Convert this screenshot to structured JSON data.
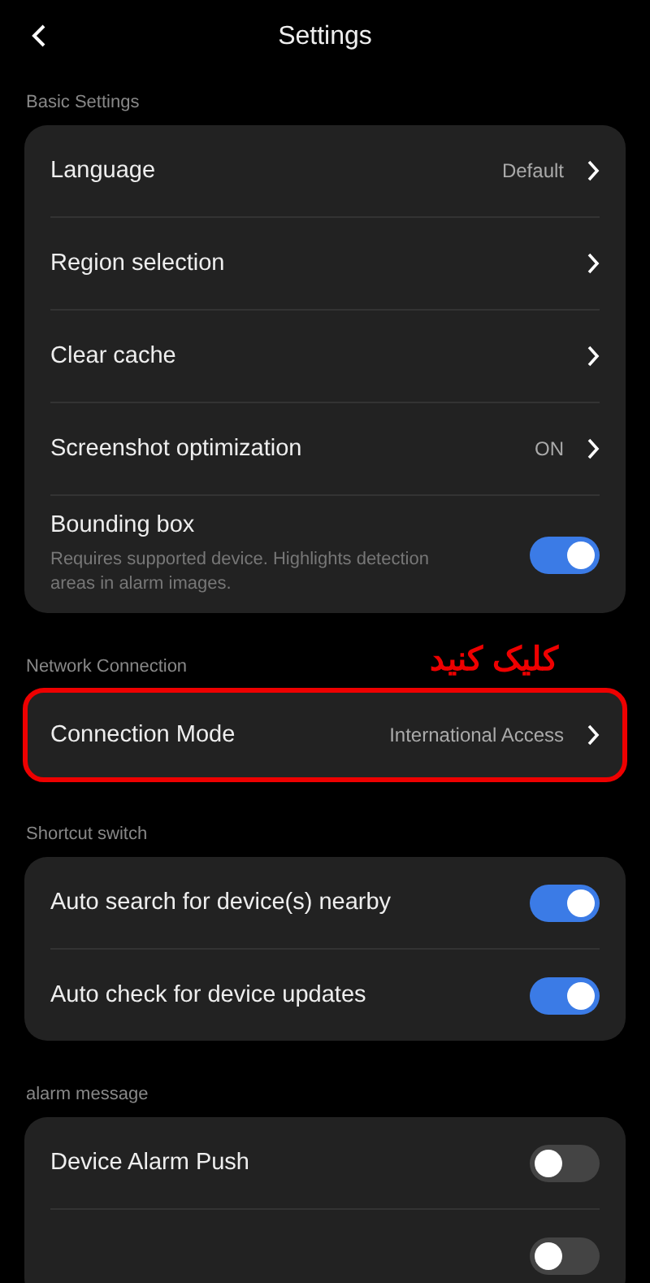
{
  "header": {
    "title": "Settings"
  },
  "sections": [
    {
      "title": "Basic Settings",
      "items": [
        {
          "kind": "link",
          "label": "Language",
          "value": "Default"
        },
        {
          "kind": "link",
          "label": "Region selection"
        },
        {
          "kind": "link",
          "label": "Clear cache"
        },
        {
          "kind": "link",
          "label": "Screenshot optimization",
          "value": "ON"
        },
        {
          "kind": "toggle",
          "label": "Bounding box",
          "description": "Requires supported device. Highlights detection areas in alarm images.",
          "on": true
        }
      ]
    },
    {
      "title": "Network Connection",
      "highlighted": true,
      "annotation": "کلیک کنید",
      "items": [
        {
          "kind": "link",
          "label": "Connection Mode",
          "value": "International Access"
        }
      ]
    },
    {
      "title": "Shortcut switch",
      "items": [
        {
          "kind": "toggle",
          "label": "Auto search for device(s) nearby",
          "on": true
        },
        {
          "kind": "toggle",
          "label": "Auto check for device updates",
          "on": true
        }
      ]
    },
    {
      "title": "alarm message",
      "items": [
        {
          "kind": "toggle",
          "label": "Device Alarm Push",
          "on": false
        },
        {
          "kind": "toggle",
          "on": false
        }
      ]
    }
  ]
}
